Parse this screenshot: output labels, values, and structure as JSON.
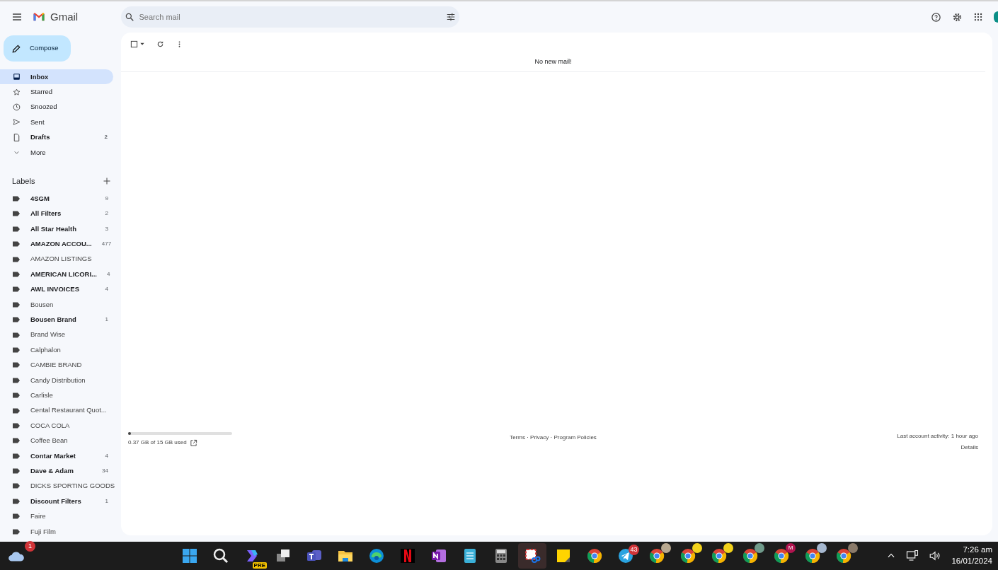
{
  "header": {
    "logo_text": "Gmail",
    "search": {
      "placeholder": "Search mail"
    }
  },
  "compose": "Compose",
  "nav": [
    {
      "label": "Inbox",
      "kind": "inbox",
      "selected": true,
      "bold": true
    },
    {
      "label": "Starred",
      "kind": "star",
      "selected": false,
      "bold": false
    },
    {
      "label": "Snoozed",
      "kind": "clock",
      "selected": false,
      "bold": false
    },
    {
      "label": "Sent",
      "kind": "send",
      "selected": false,
      "bold": false
    },
    {
      "label": "Drafts",
      "kind": "file",
      "selected": false,
      "bold": true,
      "count": "2"
    },
    {
      "label": "More",
      "kind": "chevron",
      "selected": false,
      "bold": false
    }
  ],
  "labels_title": "Labels",
  "labels": [
    {
      "name": "4SGM",
      "unread": true,
      "count": "9"
    },
    {
      "name": "All Filters",
      "unread": true,
      "count": "2"
    },
    {
      "name": "All Star Health",
      "unread": true,
      "count": "3"
    },
    {
      "name": "AMAZON ACCOU...",
      "unread": true,
      "count": "477"
    },
    {
      "name": "AMAZON LISTINGS",
      "unread": false
    },
    {
      "name": "AMERICAN LICORI...",
      "unread": true,
      "count": "4"
    },
    {
      "name": "AWL INVOICES",
      "unread": true,
      "count": "4"
    },
    {
      "name": "Bousen",
      "unread": false
    },
    {
      "name": "Bousen Brand",
      "unread": true,
      "count": "1"
    },
    {
      "name": "Brand Wise",
      "unread": false
    },
    {
      "name": "Calphalon",
      "unread": false
    },
    {
      "name": "CAMBIE BRAND",
      "unread": false
    },
    {
      "name": "Candy Distribution",
      "unread": false
    },
    {
      "name": "Carlisle",
      "unread": false
    },
    {
      "name": "Cental Restaurant Quot...",
      "unread": false
    },
    {
      "name": "COCA COLA",
      "unread": false
    },
    {
      "name": "Coffee Bean",
      "unread": false
    },
    {
      "name": "Contar Market",
      "unread": true,
      "count": "4"
    },
    {
      "name": "Dave & Adam",
      "unread": true,
      "count": "34"
    },
    {
      "name": "DICKS SPORTING GOODS",
      "unread": false
    },
    {
      "name": "Discount Filters",
      "unread": true,
      "count": "1"
    },
    {
      "name": "Faire",
      "unread": false
    },
    {
      "name": "Fuji Film",
      "unread": false
    }
  ],
  "toolbar": {
    "select_all_checked": false
  },
  "message": "No new mail!",
  "footer": {
    "storage": {
      "level": 0.025,
      "text": "0.37 GB of 15 GB used"
    },
    "links": "Terms · Privacy · Program Policies",
    "activity": "Last account activity: 1 hour ago",
    "details": "Details"
  },
  "taskbar": {
    "weather_badge": "1",
    "apps": [
      {
        "kind": "windows"
      },
      {
        "kind": "search"
      },
      {
        "kind": "copilot",
        "tag": "PRE"
      },
      {
        "kind": "taskview"
      },
      {
        "kind": "teams"
      },
      {
        "kind": "folder"
      },
      {
        "kind": "edge"
      },
      {
        "kind": "netflix"
      },
      {
        "kind": "onenote"
      },
      {
        "kind": "notepad"
      },
      {
        "kind": "calculator"
      },
      {
        "kind": "snip",
        "active": true
      },
      {
        "kind": "sticky"
      },
      {
        "kind": "chrome"
      },
      {
        "kind": "telegram",
        "badge": "43"
      },
      {
        "kind": "chrome",
        "color": "#b8a890"
      },
      {
        "kind": "chrome",
        "color": "#f2d21b"
      },
      {
        "kind": "chrome",
        "color": "#f2d21b"
      },
      {
        "kind": "chrome",
        "color": "#6f9a8a"
      },
      {
        "kind": "chrome",
        "color": "#b0144f",
        "initial": "M"
      },
      {
        "kind": "chrome",
        "color": "#a6b8d0"
      },
      {
        "kind": "chrome",
        "color": "#8a7a6a"
      }
    ],
    "time": "7:26 am",
    "date": "16/01/2024"
  }
}
